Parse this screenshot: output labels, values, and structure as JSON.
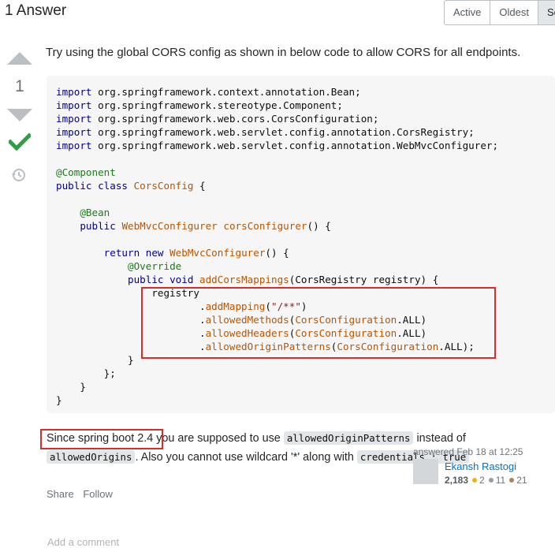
{
  "header": {
    "title": "1 Answer",
    "sort": [
      "Active",
      "Oldest",
      "Sc"
    ]
  },
  "vote": {
    "count": "1"
  },
  "post": {
    "intro": "Try using the global CORS config as shown in below code to allow CORS for all endpoints.",
    "para_a": "Since spring boot 2.4",
    "para_b": " you are supposed to use ",
    "code_a": "allowedOriginPatterns",
    "para_c": " instead of ",
    "code_b": "allowedOrigins",
    "para_d": ". Also you cannot use wildcard '*' along with ",
    "code_c": "credentials : true"
  },
  "menu": {
    "share": "Share",
    "follow": "Follow"
  },
  "signature": {
    "action": "answered Feb 18 at 12:25",
    "name": "Ekansh Rastogi",
    "rep": "2,183",
    "gold": "2",
    "silver": "11",
    "bronze": "21"
  },
  "comment": {
    "label": "Add a comment"
  },
  "colors": {
    "gold": "#f1b600",
    "silver": "#9a9c9f",
    "bronze": "#ab825f",
    "accept": "#2f9e44"
  }
}
